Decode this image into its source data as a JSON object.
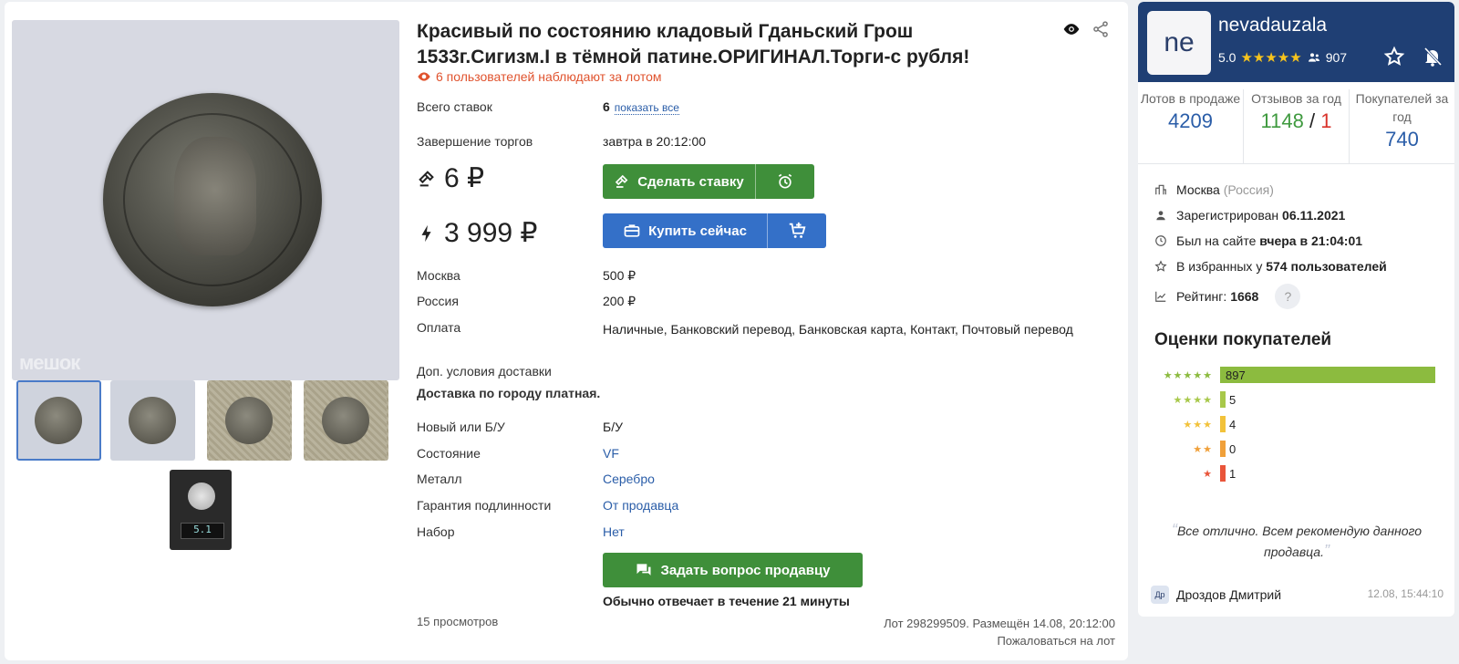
{
  "lot": {
    "title": "Красивый по состоянию кладовый Гданьский Грош 1533г.Сигизм.I в тёмной патине.ОРИГИНАЛ.Торги-с рубля!",
    "watchers": "6 пользователей наблюдают за лотом",
    "bids_label": "Всего ставок",
    "bids_count": "6",
    "bids_show_all": "показать все",
    "end_label": "Завершение торгов",
    "end_value": "завтра в 20:12:00",
    "current_price": "6 ₽",
    "buy_now_price": "3 999 ₽",
    "bid_button": "Сделать ставку",
    "buy_button": "Купить сейчас",
    "watermark": "мешок"
  },
  "shipping": [
    {
      "label": "Москва",
      "value": "500 ₽"
    },
    {
      "label": "Россия",
      "value": "200 ₽"
    },
    {
      "label": "Оплата",
      "value": "Наличные, Банковский перевод, Банковская карта, Контакт, Почтовый перевод"
    }
  ],
  "extra_delivery": {
    "label": "Доп. условия доставки",
    "value": "Доставка по городу платная."
  },
  "specs": [
    {
      "label": "Новый или Б/У",
      "value": "Б/У"
    },
    {
      "label": "Состояние",
      "value": "VF"
    },
    {
      "label": "Металл",
      "value": "Серебро"
    },
    {
      "label": "Гарантия подлинности",
      "value": "От продавца"
    },
    {
      "label": "Набор",
      "value": "Нет"
    }
  ],
  "ask": {
    "button": "Задать вопрос продавцу",
    "response": "Обычно отвечает в течение 21 минуты"
  },
  "footer": {
    "views": "15 просмотров",
    "lot_info": "Лот 298299509. Размещён 14.08, 20:12:00",
    "report": "Пожаловаться на лот"
  },
  "seller": {
    "avatar": "ne",
    "name": "nevadauzala",
    "rating": "5.0",
    "stars": "★★★★★",
    "followers": "907",
    "stats": [
      {
        "label": "Лотов в продаже",
        "value": "4209"
      },
      {
        "label": "Отзывов за год",
        "value_pos": "1148",
        "sep": "/",
        "value_neg": "1"
      },
      {
        "label": "Покупателей за год",
        "value": "740"
      }
    ],
    "city": "Москва",
    "country": "(Россия)",
    "registered_label": "Зарегистрирован",
    "registered": "06.11.2021",
    "last_seen_label": "Был на сайте",
    "last_seen": "вчера в 21:04:01",
    "favorites_label": "В избранных у",
    "favorites": "574 пользователей",
    "rating_label": "Рейтинг:",
    "rating_value": "1668",
    "help": "?"
  },
  "ratings": {
    "title": "Оценки покупателей",
    "rows": [
      {
        "stars": "★★★★★",
        "count": "897",
        "fraction": 1.0,
        "color": "#8cbb3f"
      },
      {
        "stars": "★★★★",
        "count": "5",
        "fraction": 0.006,
        "color": "#a8c84a"
      },
      {
        "stars": "★★★",
        "count": "4",
        "fraction": 0.005,
        "color": "#f2c23a"
      },
      {
        "stars": "★★",
        "count": "0",
        "fraction": 0.0,
        "color": "#f0a03a"
      },
      {
        "stars": "★",
        "count": "1",
        "fraction": 0.001,
        "color": "#e9553a"
      }
    ]
  },
  "review": {
    "text": "Все отлично. Всем рекомендую данного продавца.",
    "author_initials": "Др",
    "author": "Дроздов Дмитрий",
    "date": "12.08, 15:44:10"
  },
  "colors": {
    "accent_green": "#3f8f3a",
    "accent_blue": "#3470c8",
    "seller_header": "#1f3f74",
    "watchers": "#e0532e"
  }
}
